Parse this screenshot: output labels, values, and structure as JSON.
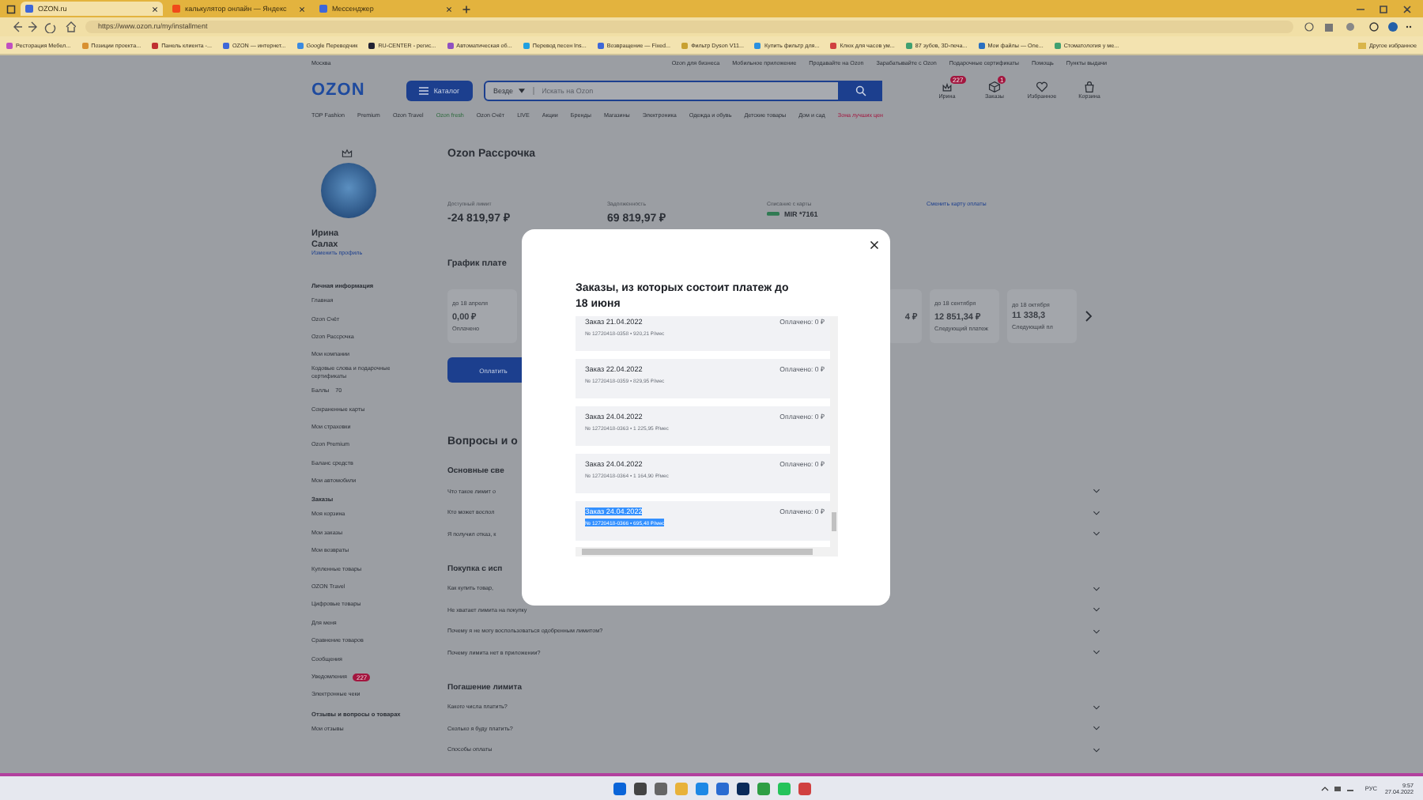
{
  "browser": {
    "tabs": [
      {
        "title": "OZON.ru",
        "selected": true
      },
      {
        "title": "калькулятор онлайн — Яндекс",
        "selected": false
      },
      {
        "title": "Мессенджер",
        "selected": false
      }
    ],
    "url": "https://www.ozon.ru/my/installment",
    "bookmarks": [
      "Ресторация Мебел...",
      "Позиции проекта...",
      "Панель клиента -...",
      "OZON — интернет...",
      "Google Переводчик",
      "RU-CENTER - регис...",
      "Автоматическая об...",
      "Перевод песен Ins...",
      "Возвращение — Fixed...",
      "Фильтр Dyson V11...",
      "Купить фильтр для...",
      "Клюх для часов ум...",
      "87 зубов, 3D-печа...",
      "Мои файлы — One...",
      "Стоматология у ме..."
    ],
    "other_bookmarks": "Другое избранное"
  },
  "header": {
    "city": "Москва",
    "top_links": [
      "Ozon для бизнеса",
      "Мобильное приложение",
      "Продавайте на Ozon",
      "Зарабатывайте с Ozon",
      "Подарочные сертификаты",
      "Помощь",
      "Пункты выдачи"
    ],
    "logo": "OZON",
    "catalog_button": "Каталог",
    "search_scope": "Везде",
    "search_placeholder": "Искать на Ozon",
    "actions": [
      {
        "label": "Ирина",
        "badge": "227",
        "kind": "profile"
      },
      {
        "label": "Заказы",
        "badge": "1",
        "kind": "orders"
      },
      {
        "label": "Избранное",
        "kind": "favorites"
      },
      {
        "label": "Корзина",
        "kind": "cart"
      }
    ],
    "nav": [
      {
        "label": "TOP Fashion",
        "kind": "regular"
      },
      {
        "label": "Premium",
        "kind": "regular"
      },
      {
        "label": "Ozon Travel",
        "kind": "regular"
      },
      {
        "label": "Ozon fresh",
        "kind": "fresh"
      },
      {
        "label": "Ozon Счёт",
        "kind": "regular"
      },
      {
        "label": "LIVE",
        "kind": "regular"
      },
      {
        "label": "Акции",
        "kind": "regular"
      },
      {
        "label": "Бренды",
        "kind": "regular"
      },
      {
        "label": "Магазины",
        "kind": "regular"
      },
      {
        "label": "Электроника",
        "kind": "regular"
      },
      {
        "label": "Одежда и обувь",
        "kind": "regular"
      },
      {
        "label": "Детские товары",
        "kind": "regular"
      },
      {
        "label": "Дом и сад",
        "kind": "regular"
      },
      {
        "label": "Зона лучших цен",
        "kind": "sale"
      }
    ]
  },
  "sidebar": {
    "first_name": "Ирина",
    "last_name": "Салах",
    "edit_link": "Изменить профиль",
    "sections": [
      {
        "title": "Личная информация",
        "items": [
          {
            "label": "Главная"
          },
          {
            "label": "Ozon Счёт"
          },
          {
            "label": "Ozon Рассрочка"
          },
          {
            "label": "Мои компании"
          },
          {
            "label": "Кодовые слова и подарочные сертификаты"
          },
          {
            "label": "Баллы",
            "count": "70"
          },
          {
            "label": "Сохраненные карты"
          },
          {
            "label": "Мои страховки"
          },
          {
            "label": "Ozon Premium"
          },
          {
            "label": "Баланс средств"
          },
          {
            "label": "Мои автомобили"
          }
        ]
      },
      {
        "title": "Заказы",
        "items": [
          {
            "label": "Моя корзина"
          },
          {
            "label": "Мои заказы"
          },
          {
            "label": "Мои возвраты"
          },
          {
            "label": "Купленные товары"
          },
          {
            "label": "OZON Travel"
          },
          {
            "label": "Цифровые товары"
          },
          {
            "label": "Для меня"
          },
          {
            "label": "Сравнение товаров"
          },
          {
            "label": "Сообщения"
          },
          {
            "label": "Уведомления",
            "badge": "227"
          },
          {
            "label": "Электронные чеки"
          }
        ]
      },
      {
        "title": "Отзывы и вопросы о товарах",
        "items": [
          {
            "label": "Мои отзывы"
          }
        ]
      }
    ]
  },
  "main": {
    "title": "Ozon Рассрочка",
    "stats": [
      {
        "label": "Доступный лимит",
        "value": "-24 819,97 ₽"
      },
      {
        "label": "Задолженность",
        "value": "69 819,97 ₽"
      },
      {
        "label": "Списание с карты",
        "value": "MIR *7161"
      }
    ],
    "change_card_link": "Сменить карту оплаты",
    "schedule_title": "График плате",
    "first_payment": {
      "date": "до 18 апреля",
      "amount": "0,00 ₽",
      "status": "Оплачено"
    },
    "partial_amount": "4 ₽",
    "payments": [
      {
        "date": "до 18 сентября",
        "amount": "12 851,34 ₽",
        "status": "Следующий платеж"
      },
      {
        "date": "до 18 октября",
        "amount": "11 338,3",
        "status": "Следующий пл"
      }
    ],
    "pay_button": "Оплатить",
    "faq_title": "Вопросы и о",
    "faq_groups": [
      {
        "title": "Основные све",
        "questions": [
          "Что такое лимит о",
          "Кто может воспол",
          "Я получил отказ, к"
        ]
      },
      {
        "title": "Покупка с исп",
        "questions": [
          "Как купить товар,",
          "Не хватает лимита на покупку",
          "Почему я не могу воспользоваться одобренным лимитом?",
          "Почему лимита нет в приложении?"
        ]
      },
      {
        "title": "Погашение лимита",
        "questions": [
          "Какого числа платить?",
          "Сколько я буду платить?",
          "Способы оплаты"
        ]
      }
    ]
  },
  "modal": {
    "title": "Заказы, из которых состоит платеж до 18 июня",
    "orders": [
      {
        "title": "Заказ 21.04.2022",
        "details": "№ 12720418-0358 • 920,21 ₽/мес",
        "paid": "Оплачено: 0 ₽",
        "highlighted": false
      },
      {
        "title": "Заказ 22.04.2022",
        "details": "№ 12720418-0359 • 829,95 ₽/мес",
        "paid": "Оплачено: 0 ₽",
        "highlighted": false
      },
      {
        "title": "Заказ 24.04.2022",
        "details": "№ 12720418-0363 • 1 225,95 ₽/мес",
        "paid": "Оплачено: 0 ₽",
        "highlighted": false
      },
      {
        "title": "Заказ 24.04.2022",
        "details": "№ 12720418-0364 • 1 164,90 ₽/мес",
        "paid": "Оплачено: 0 ₽",
        "highlighted": false
      },
      {
        "title": "Заказ 24.04.2022",
        "details": "№ 12720418-0366 • 695,48 ₽/мес",
        "paid": "Оплачено: 0 ₽",
        "highlighted": true
      }
    ]
  },
  "taskbar": {
    "language": "РУС",
    "time": "9:57",
    "date": "27.04.2022"
  }
}
